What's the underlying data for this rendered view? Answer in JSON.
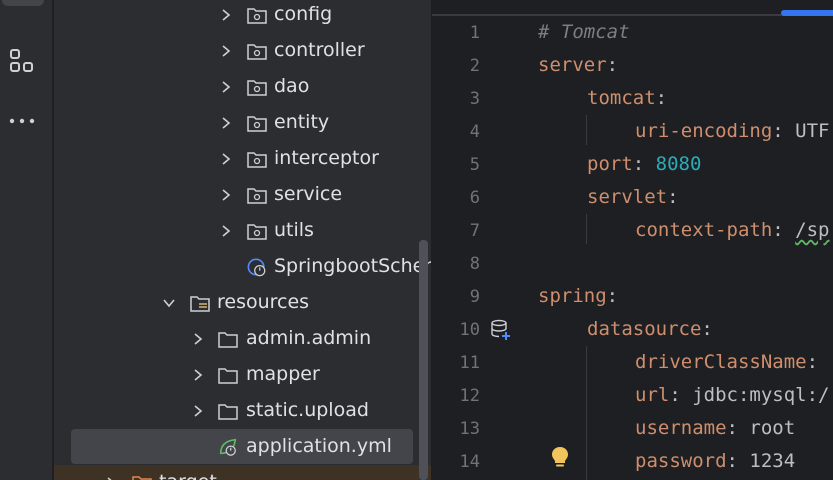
{
  "tree": {
    "items": [
      {
        "label": "config",
        "type": "package",
        "depth": 2
      },
      {
        "label": "controller",
        "type": "package",
        "depth": 2
      },
      {
        "label": "dao",
        "type": "package",
        "depth": 2
      },
      {
        "label": "entity",
        "type": "package",
        "depth": 2
      },
      {
        "label": "interceptor",
        "type": "package",
        "depth": 2
      },
      {
        "label": "service",
        "type": "package",
        "depth": 2
      },
      {
        "label": "utils",
        "type": "package",
        "depth": 2
      },
      {
        "label": "SpringbootSchen",
        "type": "spring-class",
        "depth": 2
      },
      {
        "label": "resources",
        "type": "resources-folder",
        "depth": 0
      },
      {
        "label": "admin.admin",
        "type": "folder",
        "depth": 1
      },
      {
        "label": "mapper",
        "type": "folder",
        "depth": 1
      },
      {
        "label": "static.upload",
        "type": "folder",
        "depth": 1
      },
      {
        "label": "application.yml",
        "type": "yaml-file",
        "depth": 1
      },
      {
        "label": "target",
        "type": "folder",
        "depth": -1
      }
    ],
    "selected_label": "application.yml"
  },
  "editor": {
    "line_numbers": [
      "1",
      "2",
      "3",
      "4",
      "5",
      "6",
      "7",
      "8",
      "9",
      "10",
      "11",
      "12",
      "13",
      "14"
    ],
    "lines": {
      "l1": {
        "comment": "# Tomcat"
      },
      "l2": {
        "key": "server",
        "colon": ":"
      },
      "l3": {
        "key": "tomcat",
        "colon": ":"
      },
      "l4": {
        "key": "uri-encoding",
        "colon": ": ",
        "value": "UTF"
      },
      "l5": {
        "key": "port",
        "colon": ": ",
        "value": "8080"
      },
      "l6": {
        "key": "servlet",
        "colon": ":"
      },
      "l7": {
        "key": "context-path",
        "colon": ": ",
        "value": "/sp"
      },
      "l9": {
        "key": "spring",
        "colon": ":"
      },
      "l10": {
        "key": "datasource",
        "colon": ":"
      },
      "l11": {
        "key": "driverClassName",
        "colon": ":"
      },
      "l12": {
        "key": "url",
        "colon": ": ",
        "value": "jdbc:mysql:/"
      },
      "l13": {
        "key": "username",
        "colon": ": ",
        "value": "root"
      },
      "l14": {
        "key": "password",
        "colon": ": ",
        "value": "1234"
      }
    },
    "gutter_icons": [
      "database-add-icon",
      "lightbulb-icon"
    ]
  },
  "colors": {
    "background": "#1e1f22",
    "panel": "#2b2d30",
    "key": "#cf8e6d",
    "number": "#2aacb8",
    "comment": "#7a7e85",
    "accent": "#3574f0"
  },
  "activity_bar": {
    "icons": [
      "structure-icon",
      "more-icon"
    ]
  }
}
